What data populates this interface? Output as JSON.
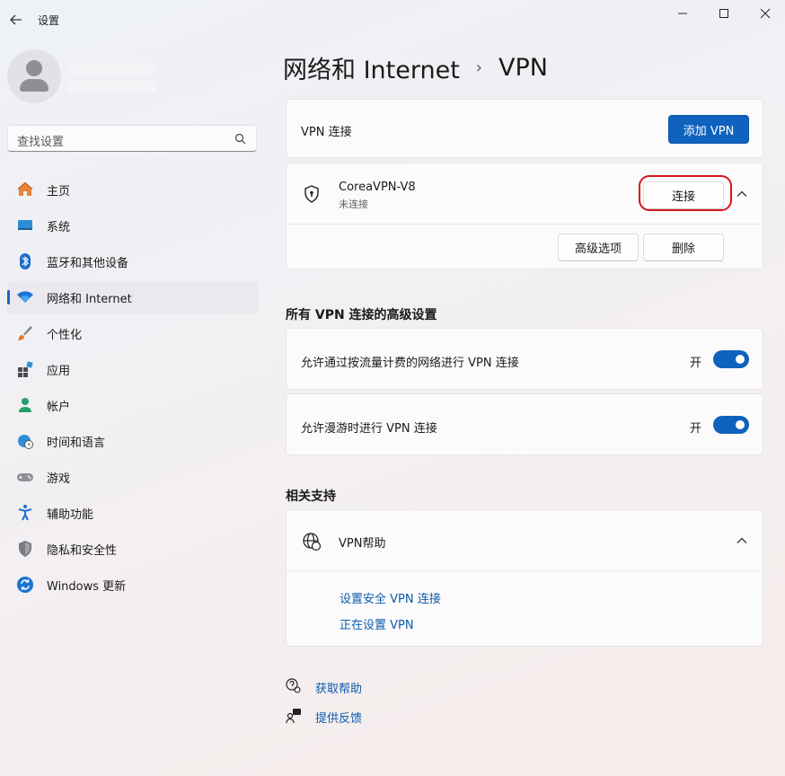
{
  "window": {
    "title": "设置",
    "controls": {
      "minimize": "—",
      "maximize": "☐",
      "close": "✕"
    }
  },
  "search": {
    "placeholder": "查找设置"
  },
  "sidebar": {
    "items": [
      {
        "label": "主页",
        "icon": "home-icon",
        "selected": false
      },
      {
        "label": "系统",
        "icon": "system-icon",
        "selected": false
      },
      {
        "label": "蓝牙和其他设备",
        "icon": "bluetooth-icon",
        "selected": false
      },
      {
        "label": "网络和 Internet",
        "icon": "wifi-icon",
        "selected": true
      },
      {
        "label": "个性化",
        "icon": "brush-icon",
        "selected": false
      },
      {
        "label": "应用",
        "icon": "apps-icon",
        "selected": false
      },
      {
        "label": "帐户",
        "icon": "account-icon",
        "selected": false
      },
      {
        "label": "时间和语言",
        "icon": "globe-clock-icon",
        "selected": false
      },
      {
        "label": "游戏",
        "icon": "gamepad-icon",
        "selected": false
      },
      {
        "label": "辅助功能",
        "icon": "accessibility-icon",
        "selected": false
      },
      {
        "label": "隐私和安全性",
        "icon": "shield-icon",
        "selected": false
      },
      {
        "label": "Windows 更新",
        "icon": "update-icon",
        "selected": false
      }
    ]
  },
  "breadcrumb": {
    "parent": "网络和 Internet",
    "separator": "›",
    "current": "VPN"
  },
  "vpn_connections": {
    "label": "VPN 连接",
    "add_button": "添加 VPN"
  },
  "vpn_item": {
    "name": "CoreaVPN-V8",
    "status": "未连接",
    "connect_button": "连接",
    "advanced_button": "高级选项",
    "delete_button": "删除"
  },
  "advanced_settings": {
    "heading": "所有 VPN 连接的高级设置",
    "metered": {
      "label": "允许通过按流量计费的网络进行 VPN 连接",
      "state": "开",
      "on": true
    },
    "roaming": {
      "label": "允许漫游时进行 VPN 连接",
      "state": "开",
      "on": true
    }
  },
  "related": {
    "heading": "相关支持",
    "help_title": "VPN帮助",
    "links": [
      "设置安全 VPN 连接",
      "正在设置 VPN"
    ]
  },
  "footer": {
    "get_help": "获取帮助",
    "feedback": "提供反馈"
  },
  "colors": {
    "accent": "#0f62bd",
    "highlight": "#d9161b",
    "link": "#0b5cad"
  }
}
